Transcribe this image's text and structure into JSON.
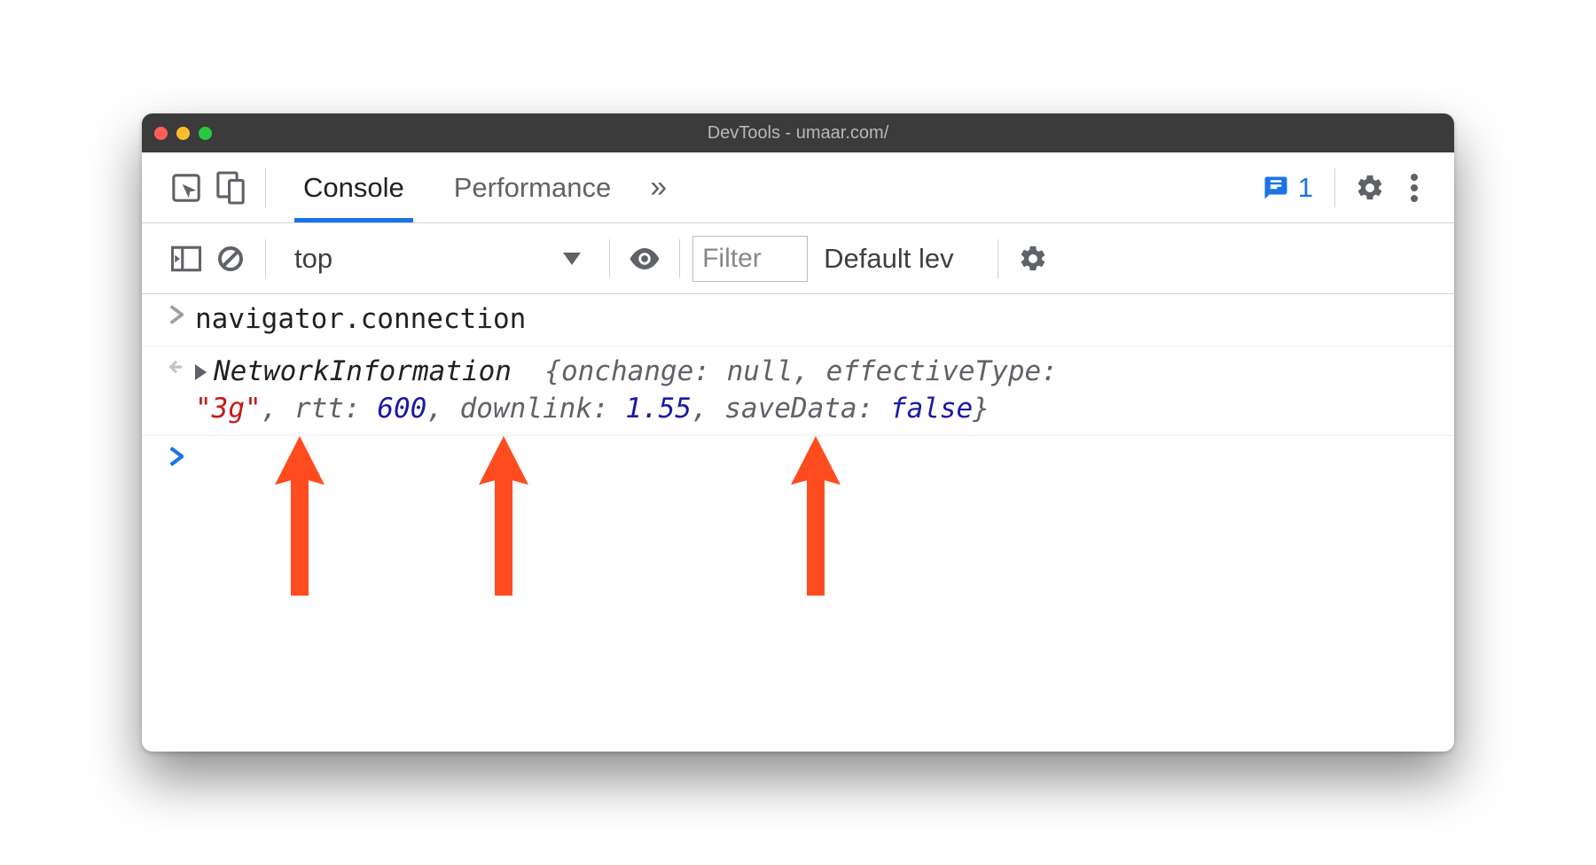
{
  "window": {
    "title": "DevTools - umaar.com/"
  },
  "tabs": {
    "console": "Console",
    "performance": "Performance",
    "more_glyph": "»"
  },
  "messages": {
    "count": "1"
  },
  "toolbar": {
    "context": "top",
    "filter_placeholder": "Filter",
    "levels": "Default lev"
  },
  "console": {
    "input": "navigator.connection",
    "result": {
      "class_name": "NetworkInformation",
      "onchange_key": "onchange",
      "onchange_val": "null",
      "effectiveType_key": "effectiveType",
      "effectiveType_val": "\"3g\"",
      "rtt_key": "rtt",
      "rtt_val": "600",
      "downlink_key": "downlink",
      "downlink_val": "1.55",
      "saveData_key": "saveData",
      "saveData_val": "false"
    }
  },
  "colors": {
    "accent": "#1a73e8",
    "arrow": "#ff4c1f"
  }
}
